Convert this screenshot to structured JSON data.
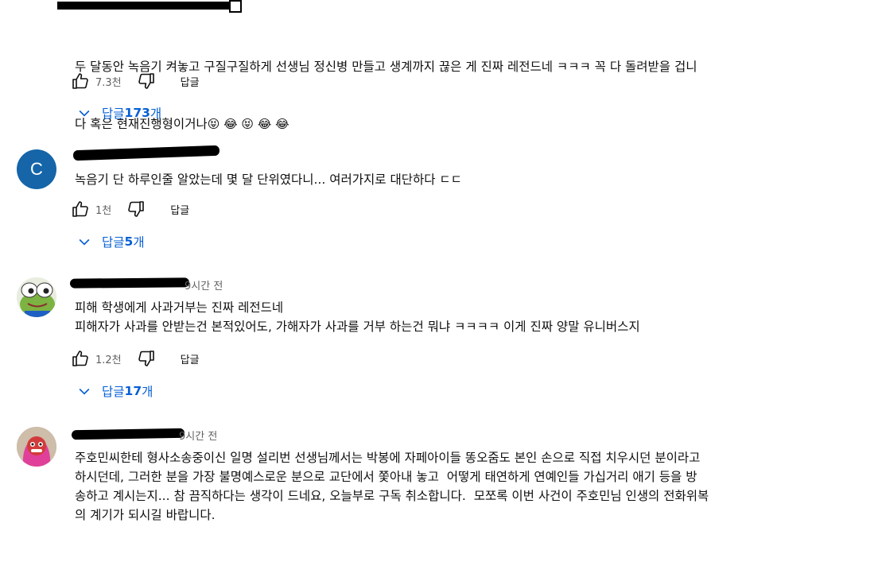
{
  "comments": [
    {
      "text_line1": "두 달동안 녹음기 켜놓고 구질구질하게 선생님 정신병 만들고 생계까지 끊은 게 진짜 레전드네 ㅋㅋㅋ 꼭 다 돌려받을 겁니",
      "text_line2": "다 혹은 현재진행형이거나",
      "text_emojis": "😝 😂 😝 😂 😂",
      "likes": "7.3천",
      "reply_label": "답글",
      "replies_label": "답글 ",
      "replies_count": "173",
      "replies_suffix": "개"
    },
    {
      "avatar_letter": "C",
      "text": "녹음기 단 하루인줄 알았는데 몇 달 단위였다니... 여러가지로 대단하다 ㄷㄷ",
      "likes": "1천",
      "reply_label": "답글",
      "replies_label": "답글 ",
      "replies_count": "5",
      "replies_suffix": "개"
    },
    {
      "time": "9시간 전",
      "text": "피해 학생에게 사과거부는 진짜 레전드네\n피해자가 사과를 안받는건 본적있어도, 가해자가 사과를 거부 하는건 뭐냐 ㅋㅋㅋㅋ 이게 진짜 양말 유니버스지",
      "likes": "1.2천",
      "reply_label": "답글",
      "replies_label": "답글 ",
      "replies_count": "17",
      "replies_suffix": "개"
    },
    {
      "time": "9시간 전",
      "text": "주호민씨한테 형사소송중이신 일명 설리번 선생님께서는 박봉에 자페아이들 똥오줌도 본인 손으로 직접 치우시던 분이라고\n하시던데, 그러한 분을 가장 불명예스로운 분으로 교단에서 쫓아내 놓고  어떻게 태연하게 연예인들 가십거리 애기 등을 방\n송하고 계시는지... 참 끔직하다는 생각이 드네요, 오늘부로 구독 취소합니다.  모쪼록 이번 사건이 주호민님 인생의 전화위복\n의 계기가 되시길 바랍니다."
    }
  ],
  "colors": {
    "link_blue": "#065fd4",
    "avatar_c_bg": "#1565a8",
    "meta_gray": "#606060"
  },
  "icons": [
    "like-icon",
    "dislike-icon",
    "chevron-down-icon"
  ]
}
